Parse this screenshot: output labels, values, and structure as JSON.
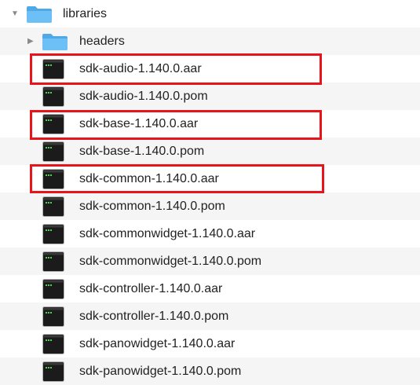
{
  "tree": {
    "root_folder": {
      "name": "libraries",
      "expanded": true,
      "icon": "folder-icon",
      "disclosure_icon": "chevron-down-icon"
    },
    "subfolder": {
      "name": "headers",
      "expanded": false,
      "icon": "folder-icon",
      "disclosure_icon": "chevron-right-icon"
    },
    "files": [
      {
        "name": "sdk-audio-1.140.0.aar",
        "icon": "terminal-file-icon",
        "highlighted": true
      },
      {
        "name": "sdk-audio-1.140.0.pom",
        "icon": "terminal-file-icon",
        "highlighted": false
      },
      {
        "name": "sdk-base-1.140.0.aar",
        "icon": "terminal-file-icon",
        "highlighted": true
      },
      {
        "name": "sdk-base-1.140.0.pom",
        "icon": "terminal-file-icon",
        "highlighted": false
      },
      {
        "name": "sdk-common-1.140.0.aar",
        "icon": "terminal-file-icon",
        "highlighted": true
      },
      {
        "name": "sdk-common-1.140.0.pom",
        "icon": "terminal-file-icon",
        "highlighted": false
      },
      {
        "name": "sdk-commonwidget-1.140.0.aar",
        "icon": "terminal-file-icon",
        "highlighted": false
      },
      {
        "name": "sdk-commonwidget-1.140.0.pom",
        "icon": "terminal-file-icon",
        "highlighted": false
      },
      {
        "name": "sdk-controller-1.140.0.aar",
        "icon": "terminal-file-icon",
        "highlighted": false
      },
      {
        "name": "sdk-controller-1.140.0.pom",
        "icon": "terminal-file-icon",
        "highlighted": false
      },
      {
        "name": "sdk-panowidget-1.140.0.aar",
        "icon": "terminal-file-icon",
        "highlighted": false
      },
      {
        "name": "sdk-panowidget-1.140.0.pom",
        "icon": "terminal-file-icon",
        "highlighted": false
      }
    ]
  },
  "colors": {
    "highlight_border": "#e8141b",
    "folder_blue": "#5fb7f2",
    "row_alternate": "#f5f5f5"
  }
}
